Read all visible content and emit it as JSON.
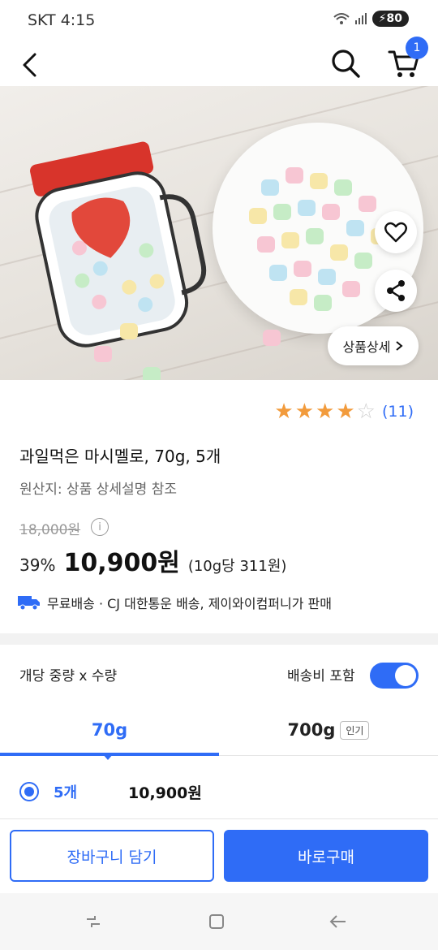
{
  "status": {
    "time": "SKT 4:15",
    "battery": "80"
  },
  "appbar": {
    "cart_count": "1"
  },
  "hero": {
    "detail_label": "상품상세"
  },
  "rating": {
    "count": "(11)",
    "score": 4,
    "max": 5
  },
  "product": {
    "title": "과일먹은 마시멜로, 70g, 5개",
    "origin": "원산지: 상품 상세설명 참조",
    "original_price": "18,000원",
    "discount": "39%",
    "price": "10,900원",
    "unit_price": "(10g당 311원)",
    "shipping": "무료배송 · CJ 대한통운 배송, 제이와이컴퍼니가 판매"
  },
  "options": {
    "header": "개당 중량 x 수량",
    "include_shipping_label": "배송비 포함",
    "include_shipping_on": true,
    "tabs": [
      {
        "label": "70g",
        "badge": ""
      },
      {
        "label": "700g",
        "badge": "인기"
      }
    ],
    "selected": {
      "qty": "5개",
      "price": "10,900원"
    }
  },
  "actions": {
    "cart_label": "장바구니 담기",
    "buy_label": "바로구매"
  },
  "colors": {
    "accent": "#2f6cf6",
    "star": "#f29b3c"
  }
}
